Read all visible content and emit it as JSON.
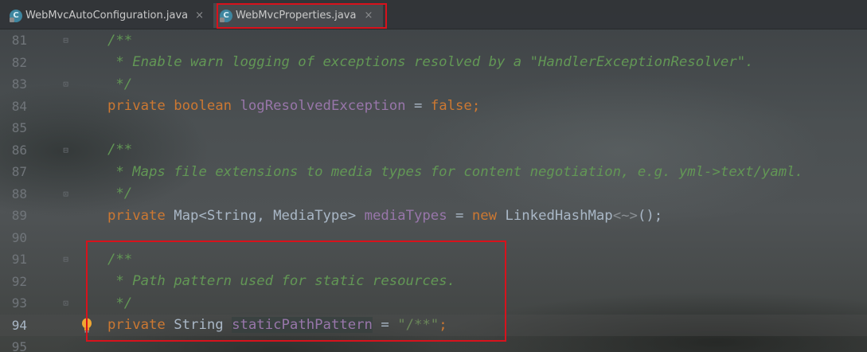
{
  "tabs": [
    {
      "label": "WebMvcAutoConfiguration.java",
      "icon": "java-class-icon",
      "close": "×"
    },
    {
      "label": "WebMvcProperties.java",
      "icon": "java-class-icon",
      "close": "×"
    }
  ],
  "lines": [
    {
      "num": "81",
      "text": "/**"
    },
    {
      "num": "82",
      "text": " * Enable warn logging of exceptions resolved by a \"HandlerExceptionResolver\"."
    },
    {
      "num": "83",
      "text": " */"
    },
    {
      "num": "84",
      "tokens": [
        "private",
        "boolean",
        "logResolvedException",
        "=",
        "false",
        ";"
      ]
    },
    {
      "num": "85",
      "text": ""
    },
    {
      "num": "86",
      "text": "/**"
    },
    {
      "num": "87",
      "text": " * Maps file extensions to media types for content negotiation, e.g. yml->text/yaml."
    },
    {
      "num": "88",
      "text": " */"
    },
    {
      "num": "89",
      "tokens": [
        "private",
        "Map<String, MediaType>",
        "mediaTypes",
        "=",
        "new",
        "LinkedHashMap",
        "<~>",
        "();"
      ]
    },
    {
      "num": "90",
      "text": ""
    },
    {
      "num": "91",
      "text": "/**"
    },
    {
      "num": "92",
      "text": " * Path pattern used for static resources."
    },
    {
      "num": "93",
      "text": " */"
    },
    {
      "num": "94",
      "tokens": [
        "private",
        "String",
        "staticPathPattern",
        "=",
        "\"/**\"",
        ";"
      ]
    },
    {
      "num": "95",
      "text": ""
    }
  ],
  "colors": {
    "keyword": "#cc7832",
    "doc_comment": "#629755",
    "field": "#9876aa",
    "string": "#6a8759",
    "plain": "#a9b7c6",
    "highlight_box": "#d8121c"
  }
}
